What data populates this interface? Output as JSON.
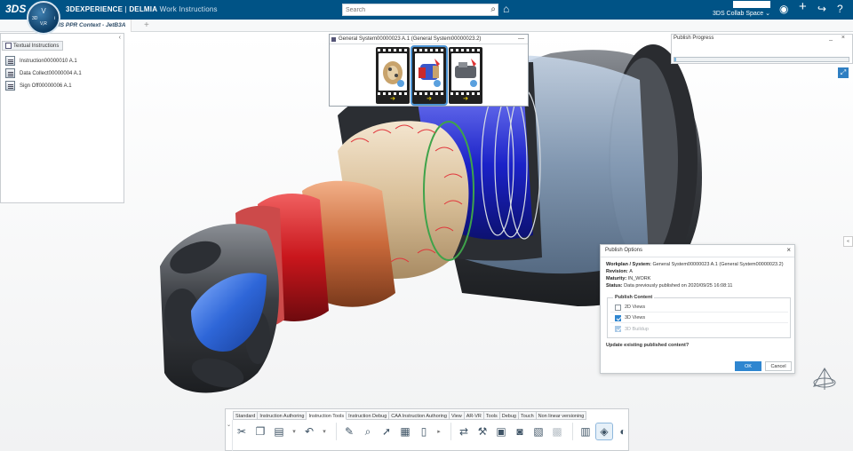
{
  "header": {
    "ds_logo": "3DS",
    "compass_top": "V",
    "compass_3d": "3D",
    "compass_i": "i",
    "compass_ver": "V,R",
    "brand_main": "3DEXPERIENCE",
    "brand_sep": " | ",
    "brand_product": "DELMIA",
    "brand_app": "Work Instructions",
    "search_placeholder": "Search",
    "collab_space": "3DS Collab Space",
    "icons": [
      "search-icon",
      "tag-icon",
      "user-icon",
      "add-icon",
      "share-icon",
      "help-icon"
    ]
  },
  "tabs": {
    "active": "YMS PPR Context - JetB3A",
    "add": "+"
  },
  "textual_panel": {
    "collapse": "‹",
    "tab_label": "Textual Instructions",
    "items": [
      {
        "label": "Instruction00000010 A.1"
      },
      {
        "label": "Data Collect00000004 A.1"
      },
      {
        "label": "Sign Off00000006 A.1"
      }
    ]
  },
  "filmstrip": {
    "title": "General System00000023 A.1 (General System00000023.2)",
    "minimize": "—",
    "frame_arrow": "➔"
  },
  "progress": {
    "title": "Publish Progress",
    "buttons": "_ ×",
    "value": 0.01
  },
  "viewport": {
    "fit_icon": "⤢",
    "side_handle": "«",
    "accent": "#2f86d0"
  },
  "dialog": {
    "title": "Publish Options",
    "close": "×",
    "workplan_label": "Workplan / System: ",
    "workplan_value": "General System00000023 A.1 (General System00000023.2)",
    "revision_label": "Revision: ",
    "revision_value": "A",
    "maturity_label": "Maturity: ",
    "maturity_value": "IN_WORK",
    "status_label": "Status: ",
    "status_value": "Data previously published on 2020/09/25 16:08:11",
    "publish_content": "Publish Content",
    "options": [
      {
        "label": "2D Views",
        "checked": false,
        "disabled": false
      },
      {
        "label": "3D Views",
        "checked": true,
        "disabled": false
      },
      {
        "label": "3D Buildup",
        "checked": true,
        "disabled": true
      }
    ],
    "update_question": "Update existing published content?",
    "ok": "OK",
    "cancel": "Cancel"
  },
  "toolbar": {
    "collapse": "⌄",
    "tabs": [
      "Standard",
      "Instruction Authoring",
      "Instruction Tools",
      "Instruction Debug",
      "CAA Instruction Authoring",
      "View",
      "AR-VR",
      "Tools",
      "Debug",
      "Touch",
      "Non linear versioning"
    ],
    "active_tab": "Instruction Tools"
  }
}
